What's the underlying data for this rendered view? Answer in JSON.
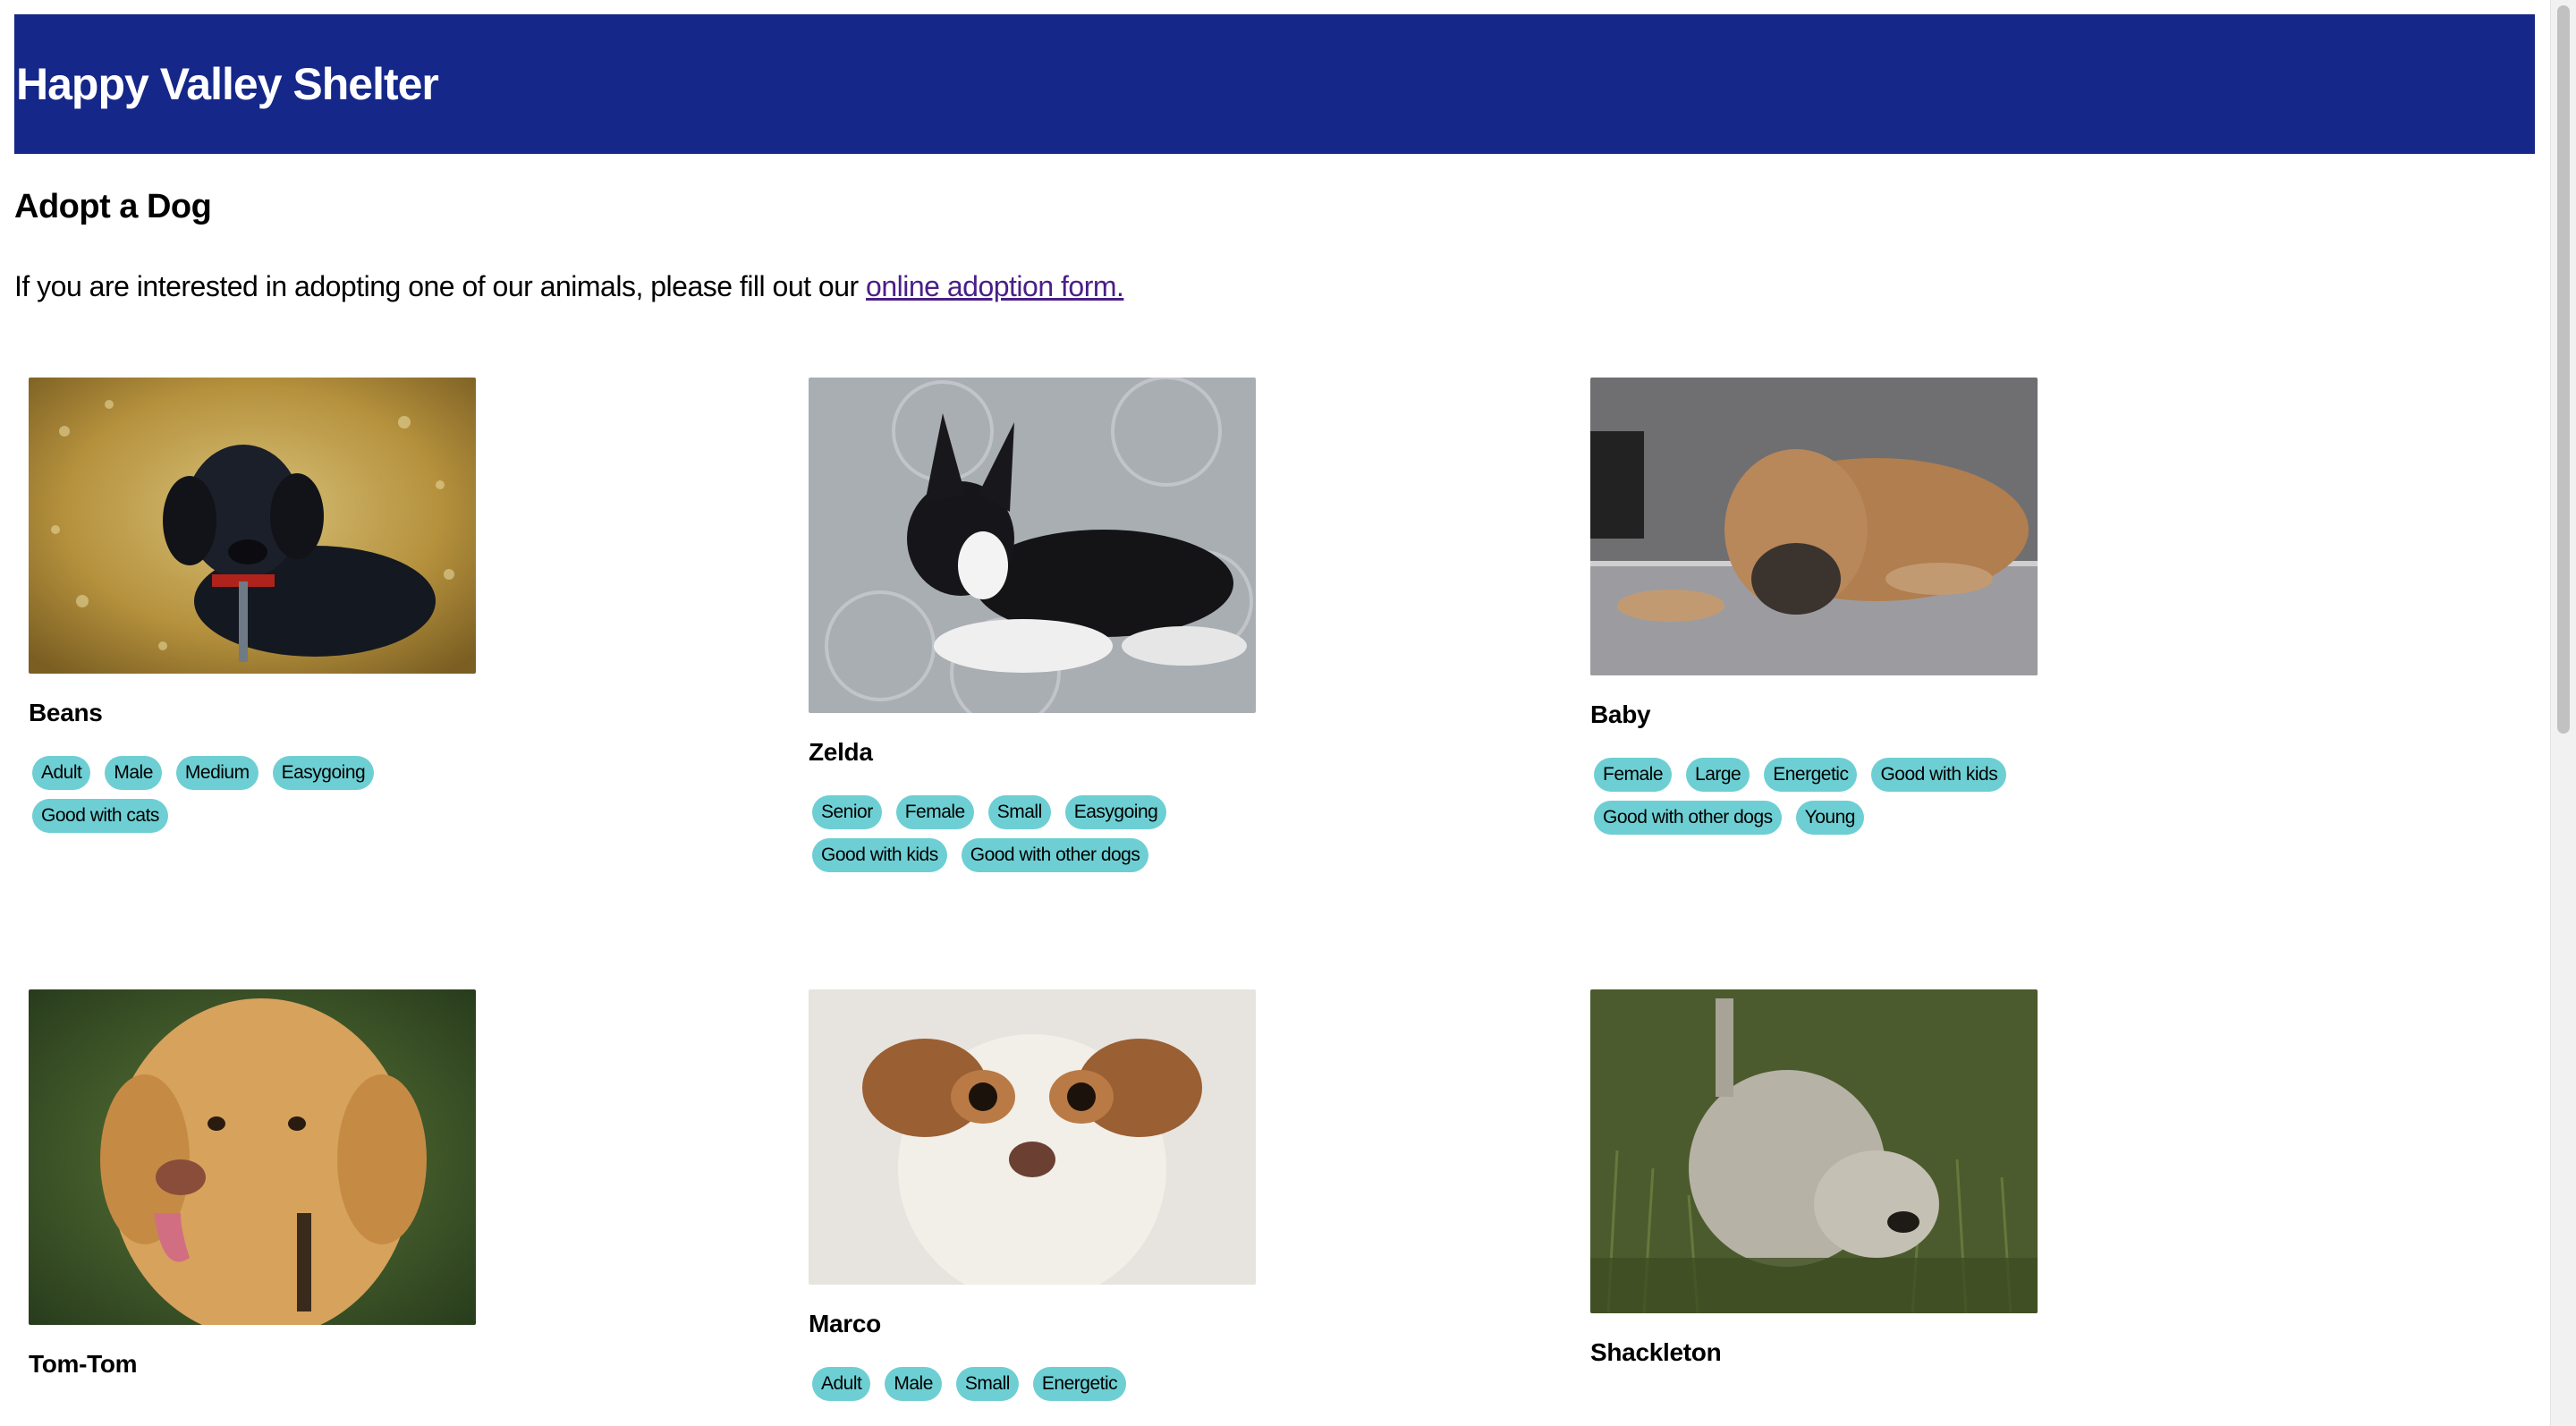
{
  "header": {
    "title": "Happy Valley Shelter"
  },
  "main": {
    "heading": "Adopt a Dog",
    "intro_text": "If you are interested in adopting one of our animals, please fill out our ",
    "intro_link": "online adoption form."
  },
  "dogs": [
    {
      "name": "Beans",
      "tags": [
        "Adult",
        "Male",
        "Medium",
        "Easygoing",
        "Good with cats"
      ]
    },
    {
      "name": "Zelda",
      "tags": [
        "Senior",
        "Female",
        "Small",
        "Easygoing",
        "Good with kids",
        "Good with other dogs"
      ]
    },
    {
      "name": "Baby",
      "tags": [
        "Female",
        "Large",
        "Energetic",
        "Good with kids",
        "Good with other dogs",
        "Young"
      ]
    },
    {
      "name": "Tom-Tom",
      "tags": []
    },
    {
      "name": "Marco",
      "tags": [
        "Adult",
        "Male",
        "Small",
        "Energetic"
      ]
    },
    {
      "name": "Shackleton",
      "tags": []
    }
  ],
  "colors": {
    "banner": "#152789",
    "tag": "#6dcfd3",
    "link": "#4a1f87"
  }
}
